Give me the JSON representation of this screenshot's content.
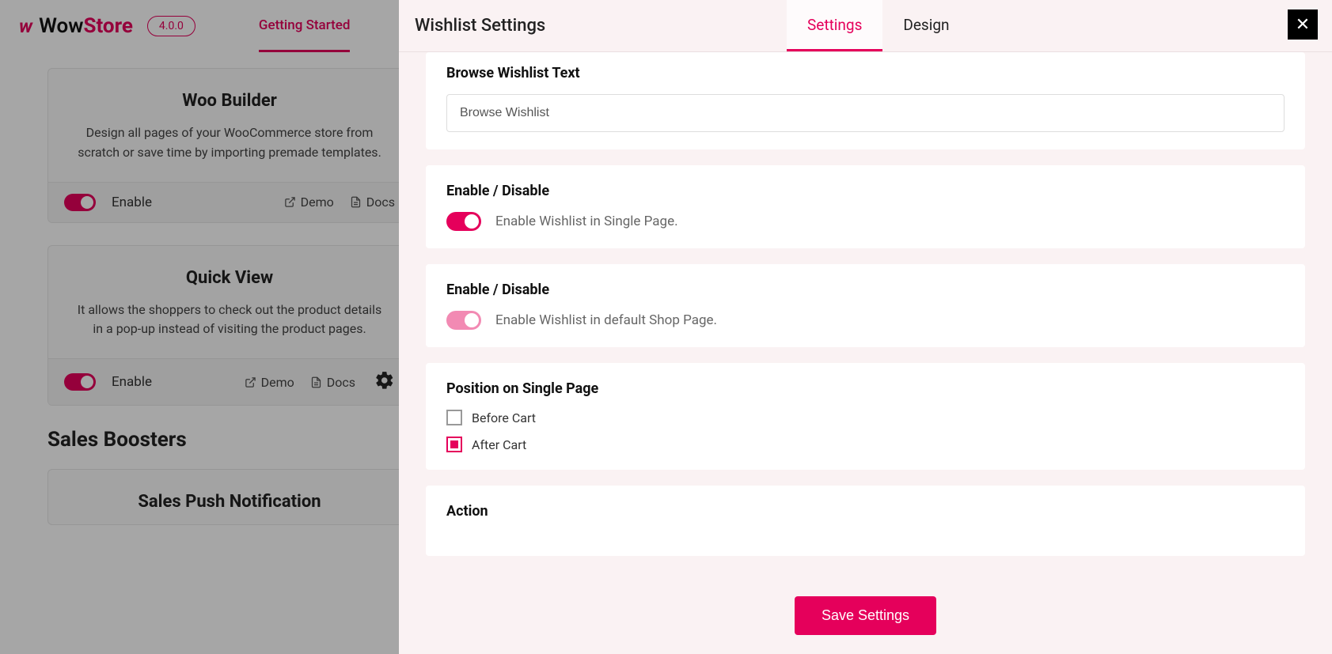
{
  "header": {
    "brand_wow": "Wow",
    "brand_store": "Store",
    "version": "4.0.0",
    "tab_getting_started": "Getting Started"
  },
  "cards": {
    "woo_builder": {
      "title": "Woo Builder",
      "desc": "Design all pages of your WooCommerce store from scratch or save time by importing premade templates.",
      "enable": "Enable",
      "demo": "Demo",
      "docs": "Docs"
    },
    "quick_view": {
      "title": "Quick View",
      "desc": "It allows the shoppers to check out the product details in a pop-up instead of visiting the product pages.",
      "enable": "Enable",
      "demo": "Demo",
      "docs": "Docs"
    },
    "sales_boosters_heading": "Sales Boosters",
    "sales_push": {
      "title": "Sales Push Notification"
    }
  },
  "modal": {
    "title": "Wishlist Settings",
    "tabs": {
      "settings": "Settings",
      "design": "Design"
    },
    "sections": {
      "browse_text": {
        "label": "Browse Wishlist Text",
        "value": "Browse Wishlist"
      },
      "single_page": {
        "label": "Enable / Disable",
        "desc": "Enable Wishlist in Single Page."
      },
      "shop_page": {
        "label": "Enable / Disable",
        "desc": "Enable Wishlist in default Shop Page."
      },
      "position": {
        "label": "Position on Single Page",
        "options": {
          "before": "Before Cart",
          "after": "After Cart"
        }
      },
      "action": {
        "label": "Action"
      }
    },
    "save": "Save Settings"
  }
}
